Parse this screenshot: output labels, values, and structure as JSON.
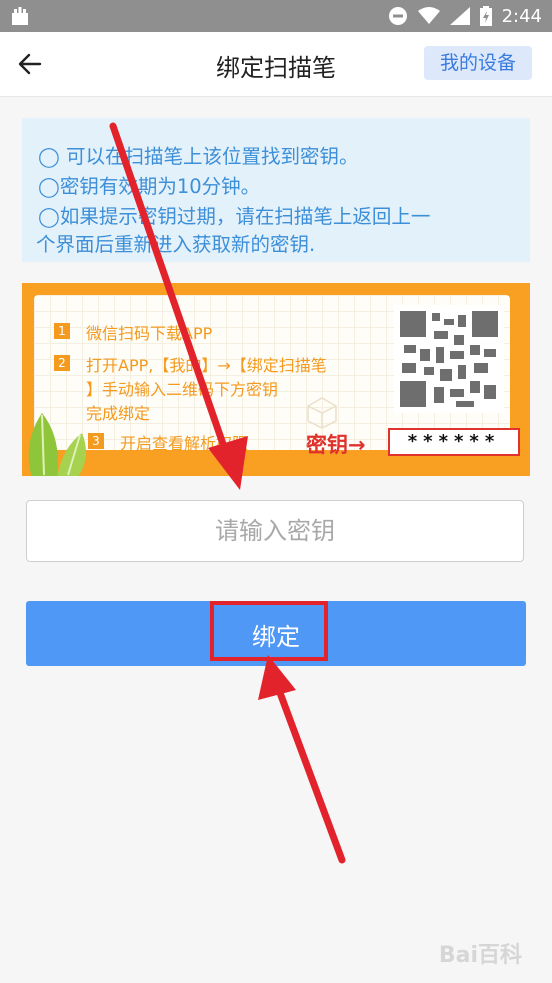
{
  "status_bar": {
    "time": "2:44"
  },
  "header": {
    "title": "绑定扫描笔",
    "my_device_label": "我的设备"
  },
  "info": {
    "lines": [
      "◯ 可以在扫描笔上该位置找到密钥。",
      "◯密钥有效期为10分钟。",
      "◯如果提示密钥过期，请在扫描笔上返回上一",
      "个界面后重新进入获取新的密钥."
    ]
  },
  "card": {
    "steps": [
      {
        "num": "1",
        "text": "微信扫码下载APP"
      },
      {
        "num": "2",
        "text": "打开APP,【我的】→【绑定扫描笔"
      },
      {
        "num": "",
        "text": "】手动输入二维码下方密钥"
      },
      {
        "num": "",
        "text": "完成绑定"
      },
      {
        "num": "3",
        "text": "开启查看解析权限"
      }
    ],
    "key_label": "密钥→",
    "key_mask": "******"
  },
  "input": {
    "placeholder": "请输入密钥",
    "value": ""
  },
  "bind_button": {
    "label": "绑定"
  },
  "watermark": "Bai百科",
  "colors": {
    "accent": "#4f98f6",
    "annotation": "#e3232b",
    "card": "#f9a022",
    "info_text": "#3d8fd8"
  }
}
